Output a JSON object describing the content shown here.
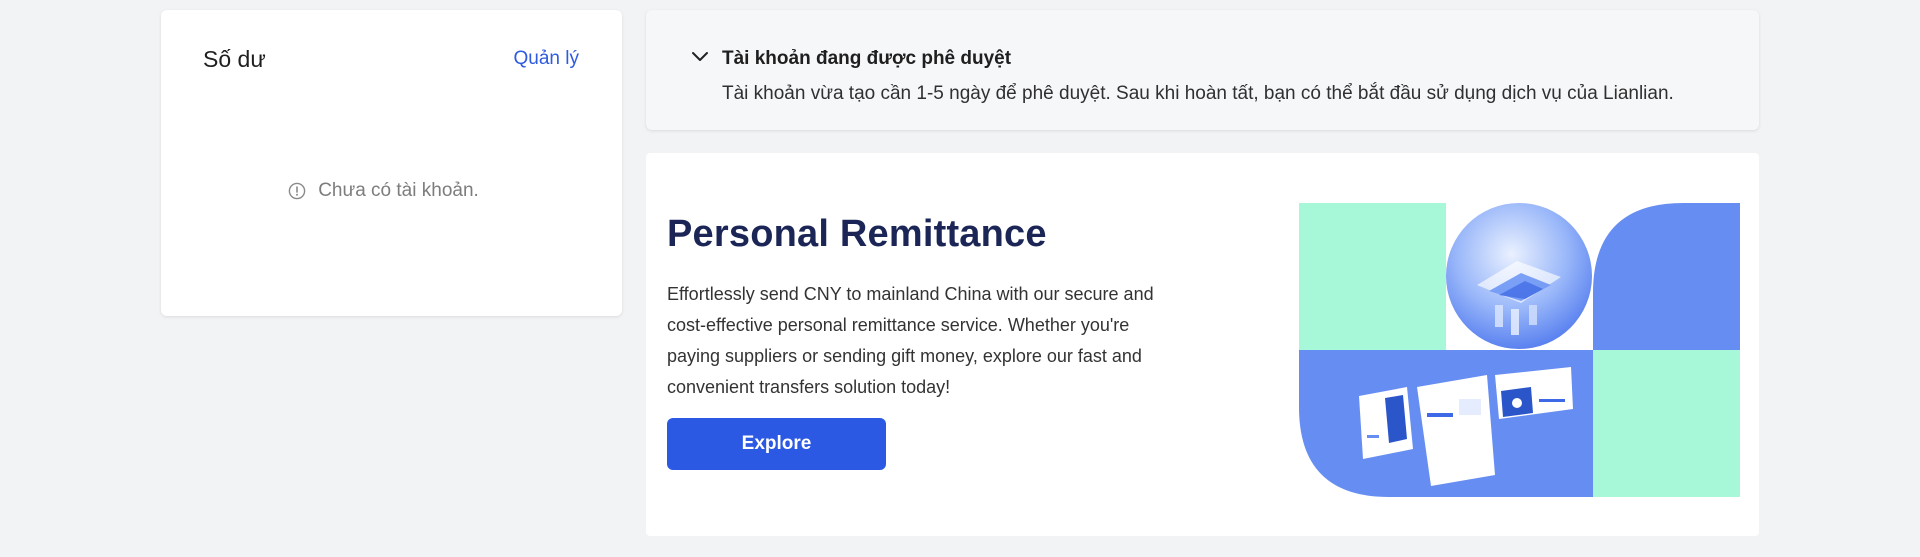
{
  "balance": {
    "title": "Số dư",
    "manage_link": "Quản lý",
    "empty_message": "Chưa có tài khoản."
  },
  "notice": {
    "title": "Tài khoản đang được phê duyệt",
    "description": "Tài khoản vừa tạo cần 1-5 ngày để phê duyệt. Sau khi hoàn tất, bạn có thể bắt đầu sử dụng dịch vụ của Lianlian."
  },
  "promo": {
    "title": "Personal Remittance",
    "description": "Effortlessly send CNY to mainland China with our secure and cost-effective personal remittance service. Whether you're paying suppliers or sending gift money, explore our fast and convenient transfers solution today!",
    "button_label": "Explore"
  },
  "colors": {
    "accent": "#2b59e3",
    "link": "#2e5bdf",
    "illustration_mint": "#a6f8d8",
    "illustration_blue": "#668df2"
  },
  "icons": {
    "empty": "info-circle-icon",
    "notice_toggle": "chevron-down-icon"
  }
}
